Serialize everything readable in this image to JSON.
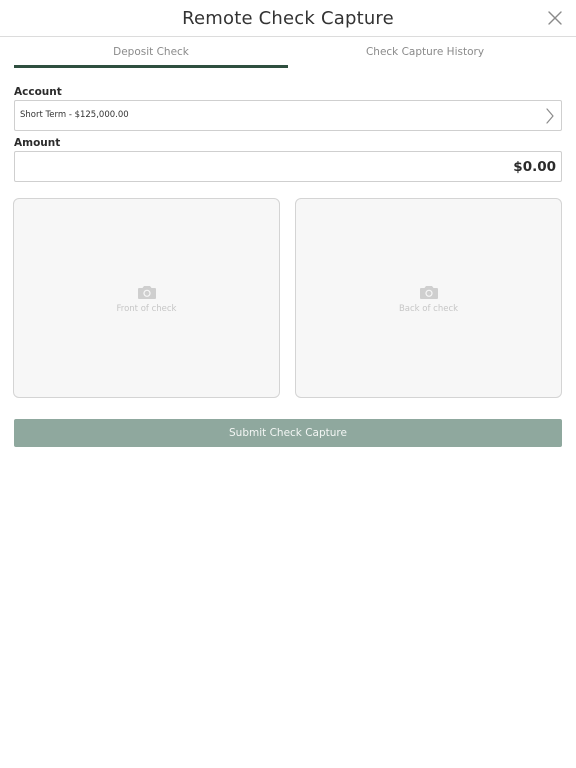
{
  "header": {
    "title": "Remote Check Capture",
    "close_icon": "close-icon"
  },
  "tabs": [
    {
      "label": "Deposit Check",
      "active": true
    },
    {
      "label": "Check Capture History",
      "active": false
    }
  ],
  "form": {
    "account_label": "Account",
    "account_value": "Short Term - $125,000.00",
    "amount_label": "Amount",
    "amount_value": "$0.00"
  },
  "check_images": {
    "front_caption": "Front of check",
    "back_caption": "Back of check",
    "icon": "camera-icon"
  },
  "submit": {
    "label": "Submit Check Capture"
  },
  "colors": {
    "accent": "#2f4f3f",
    "submit_bg": "#8fa89e",
    "check_box_bg": "#f7f7f7"
  }
}
